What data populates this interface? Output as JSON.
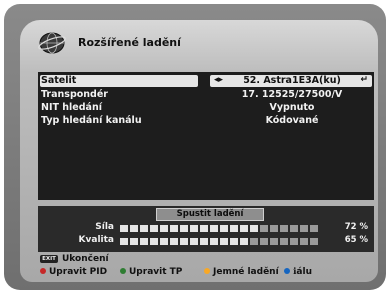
{
  "header": {
    "title": "Rozšířené ladění",
    "logo_icon": "globe-icon"
  },
  "menu": {
    "rows": [
      {
        "label": "Satelit",
        "value": "52. Astra1E3A(ku)"
      },
      {
        "label": "Transpondér",
        "value": "17. 12525/27500/V"
      },
      {
        "label": "NIT hledání",
        "value": "Vypnuto"
      },
      {
        "label": "Typ hledání kanálu",
        "value": "Kódované"
      }
    ],
    "selected_index": 0
  },
  "scan": {
    "button_label": "Spustit ladění",
    "signal": {
      "label": "Síla",
      "percent_text": "72 %",
      "level": 72
    },
    "quality": {
      "label": "Kvalita",
      "percent_text": "65 %",
      "level": 65
    }
  },
  "footer": {
    "exit_key": "EXIT",
    "exit_label": "Ukončení",
    "keys": [
      {
        "label": "Upravit PID",
        "color": "#c62828"
      },
      {
        "label": "Upravit TP",
        "color": "#2e7d32"
      },
      {
        "label": "Jemné ladění",
        "color": "#f9a825"
      },
      {
        "label": "ℹálu",
        "color": "#1565c0"
      }
    ]
  },
  "colors": {
    "menu_bg": "#1d1d1d",
    "selection_bg": "#e6e6e6",
    "panel_bg": "#bdbdbd"
  }
}
